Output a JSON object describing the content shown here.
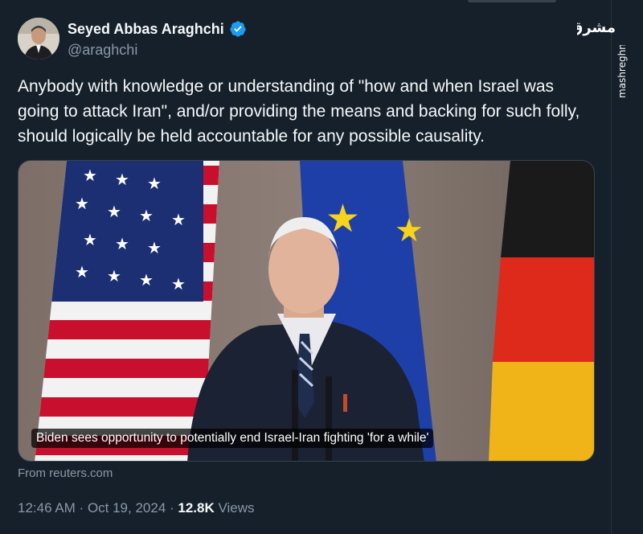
{
  "author": {
    "display_name": "Seyed Abbas Araghchi",
    "handle": "@araghchi",
    "verified_icon": "verified-badge-icon"
  },
  "tweet": {
    "text": "Anybody with knowledge or understanding of \"how and when Israel was going to attack Iran\", and/or providing the means and backing for such folly, should logically be held accountable for any possible causality."
  },
  "media": {
    "caption": "Biden sees opportunity to potentially end Israel-Iran fighting 'for a while'",
    "source": "From reuters.com"
  },
  "meta": {
    "time": "12:46 AM",
    "separator": " · ",
    "date": "Oct 19, 2024",
    "views_count": "12.8K",
    "views_label": " Views"
  },
  "watermark": {
    "logo_text": "مشرق",
    "site": "mashreghnews.ir"
  },
  "colors": {
    "background": "#15202b",
    "text": "#f7f9f9",
    "secondary": "#8b98a5",
    "verified": "#1d9bf0"
  }
}
